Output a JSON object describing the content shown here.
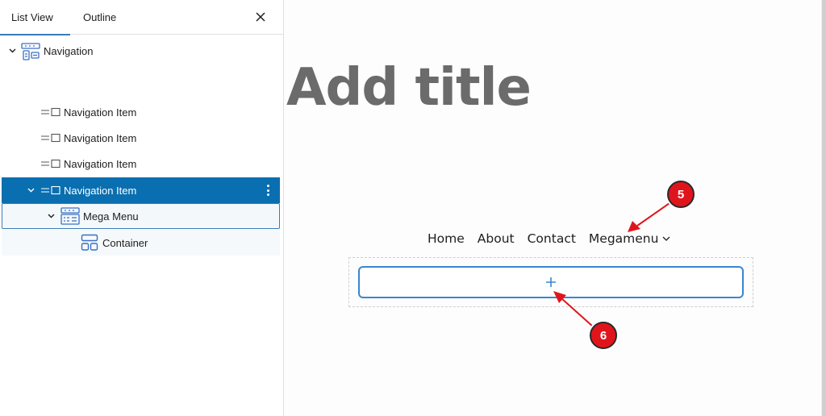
{
  "sidebar": {
    "tabs": [
      {
        "label": "List View",
        "active": true
      },
      {
        "label": "Outline",
        "active": false
      }
    ],
    "close_icon": "close-icon",
    "tree": [
      {
        "label": "Navigation",
        "icon": "navigation-block-icon",
        "expanded": true,
        "level": 1
      },
      {
        "label": "Navigation Item",
        "icon": "navigation-item-icon",
        "level": 2
      },
      {
        "label": "Navigation Item",
        "icon": "navigation-item-icon",
        "level": 2
      },
      {
        "label": "Navigation Item",
        "icon": "navigation-item-icon",
        "level": 2
      },
      {
        "label": "Navigation Item",
        "icon": "navigation-item-icon",
        "level": 2,
        "expanded": true,
        "selected": true
      },
      {
        "label": "Mega Menu",
        "icon": "mega-menu-icon",
        "level": 3,
        "expanded": true
      },
      {
        "label": "Container",
        "icon": "container-icon",
        "level": 4
      }
    ]
  },
  "canvas": {
    "title_placeholder": "Add title",
    "nav_links": [
      "Home",
      "About",
      "Contact",
      "Megamenu"
    ],
    "appender_icon": "plus-icon"
  },
  "annotations": [
    {
      "number": "5",
      "color": "#e0151c"
    },
    {
      "number": "6",
      "color": "#e0151c"
    }
  ],
  "colors": {
    "accent": "#0a6fb0",
    "appender_border": "#3a86d0",
    "annotation": "#e0151c"
  }
}
